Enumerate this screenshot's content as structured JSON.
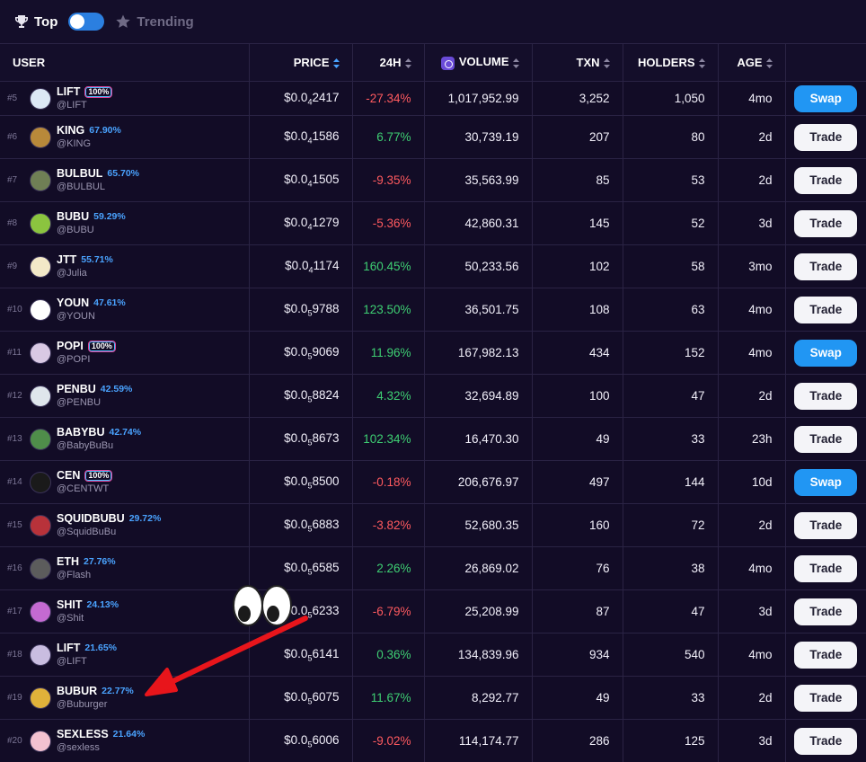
{
  "header": {
    "top_label": "Top",
    "trending_label": "Trending"
  },
  "columns": {
    "user": "USER",
    "price": "PRICE",
    "change": "24H",
    "volume": "VOLUME",
    "txn": "TXN",
    "holders": "HOLDERS",
    "age": "AGE"
  },
  "colors": {
    "accent_blue": "#2196f3",
    "percent_blue": "#4aa3ff",
    "negative": "#ff5a5f",
    "positive": "#3ecf73",
    "annotation_arrow": "#e8151b"
  },
  "rows": [
    {
      "rank": "#5",
      "symbol": "LIFT",
      "badge": "100%",
      "pct": "",
      "handle": "@LIFT",
      "price_pre": "$0.0",
      "price_sub": "4",
      "price_post": "2417",
      "change": "-27.34%",
      "volume": "1,017,952.99",
      "txn": "3,252",
      "holders": "1,050",
      "age": "4mo",
      "action": "Swap",
      "avatar": "#dce8f5"
    },
    {
      "rank": "#6",
      "symbol": "KING",
      "badge": "",
      "pct": "67.90%",
      "handle": "@KING",
      "price_pre": "$0.0",
      "price_sub": "4",
      "price_post": "1586",
      "change": "6.77%",
      "volume": "30,739.19",
      "txn": "207",
      "holders": "80",
      "age": "2d",
      "action": "Trade",
      "avatar": "#b8893a"
    },
    {
      "rank": "#7",
      "symbol": "BULBUL",
      "badge": "",
      "pct": "65.70%",
      "handle": "@BULBUL",
      "price_pre": "$0.0",
      "price_sub": "4",
      "price_post": "1505",
      "change": "-9.35%",
      "volume": "35,563.99",
      "txn": "85",
      "holders": "53",
      "age": "2d",
      "action": "Trade",
      "avatar": "#6f7f55"
    },
    {
      "rank": "#8",
      "symbol": "BUBU",
      "badge": "",
      "pct": "59.29%",
      "handle": "@BUBU",
      "price_pre": "$0.0",
      "price_sub": "4",
      "price_post": "1279",
      "change": "-5.36%",
      "volume": "42,860.31",
      "txn": "145",
      "holders": "52",
      "age": "3d",
      "action": "Trade",
      "avatar": "#8bc43f"
    },
    {
      "rank": "#9",
      "symbol": "JTT",
      "badge": "",
      "pct": "55.71%",
      "handle": "@Julia",
      "price_pre": "$0.0",
      "price_sub": "4",
      "price_post": "1174",
      "change": "160.45%",
      "volume": "50,233.56",
      "txn": "102",
      "holders": "58",
      "age": "3mo",
      "action": "Trade",
      "avatar": "#f3e9c8"
    },
    {
      "rank": "#10",
      "symbol": "YOUN",
      "badge": "",
      "pct": "47.61%",
      "handle": "@YOUN",
      "price_pre": "$0.0",
      "price_sub": "5",
      "price_post": "9788",
      "change": "123.50%",
      "volume": "36,501.75",
      "txn": "108",
      "holders": "63",
      "age": "4mo",
      "action": "Trade",
      "avatar": "#ffffff"
    },
    {
      "rank": "#11",
      "symbol": "POPI",
      "badge": "100%",
      "pct": "",
      "handle": "@POPI",
      "price_pre": "$0.0",
      "price_sub": "5",
      "price_post": "9069",
      "change": "11.96%",
      "volume": "167,982.13",
      "txn": "434",
      "holders": "152",
      "age": "4mo",
      "action": "Swap",
      "avatar": "#d9c9e4"
    },
    {
      "rank": "#12",
      "symbol": "PENBU",
      "badge": "",
      "pct": "42.59%",
      "handle": "@PENBU",
      "price_pre": "$0.0",
      "price_sub": "5",
      "price_post": "8824",
      "change": "4.32%",
      "volume": "32,694.89",
      "txn": "100",
      "holders": "47",
      "age": "2d",
      "action": "Trade",
      "avatar": "#dfe6ec"
    },
    {
      "rank": "#13",
      "symbol": "BABYBU",
      "badge": "",
      "pct": "42.74%",
      "handle": "@BabyBuBu",
      "price_pre": "$0.0",
      "price_sub": "5",
      "price_post": "8673",
      "change": "102.34%",
      "volume": "16,470.30",
      "txn": "49",
      "holders": "33",
      "age": "23h",
      "action": "Trade",
      "avatar": "#4f8d4a"
    },
    {
      "rank": "#14",
      "symbol": "CEN",
      "badge": "100%",
      "pct": "",
      "handle": "@CENTWT",
      "price_pre": "$0.0",
      "price_sub": "5",
      "price_post": "8500",
      "change": "-0.18%",
      "volume": "206,676.97",
      "txn": "497",
      "holders": "144",
      "age": "10d",
      "action": "Swap",
      "avatar": "#1a1a1a"
    },
    {
      "rank": "#15",
      "symbol": "SQUIDBUBU",
      "badge": "",
      "pct": "29.72%",
      "handle": "@SquidBuBu",
      "price_pre": "$0.0",
      "price_sub": "5",
      "price_post": "6883",
      "change": "-3.82%",
      "volume": "52,680.35",
      "txn": "160",
      "holders": "72",
      "age": "2d",
      "action": "Trade",
      "avatar": "#b8323a"
    },
    {
      "rank": "#16",
      "symbol": "ETH",
      "badge": "",
      "pct": "27.76%",
      "handle": "@Flash",
      "price_pre": "$0.0",
      "price_sub": "5",
      "price_post": "6585",
      "change": "2.26%",
      "volume": "26,869.02",
      "txn": "76",
      "holders": "38",
      "age": "4mo",
      "action": "Trade",
      "avatar": "#5c5c5c"
    },
    {
      "rank": "#17",
      "symbol": "SHIT",
      "badge": "",
      "pct": "24.13%",
      "handle": "@Shit",
      "price_pre": "$0.0",
      "price_sub": "5",
      "price_post": "6233",
      "change": "-6.79%",
      "volume": "25,208.99",
      "txn": "87",
      "holders": "47",
      "age": "3d",
      "action": "Trade",
      "avatar": "#c46ad2"
    },
    {
      "rank": "#18",
      "symbol": "LIFT",
      "badge": "",
      "pct": "21.65%",
      "handle": "@LIFT",
      "price_pre": "$0.0",
      "price_sub": "5",
      "price_post": "6141",
      "change": "0.36%",
      "volume": "134,839.96",
      "txn": "934",
      "holders": "540",
      "age": "4mo",
      "action": "Trade",
      "avatar": "#c9bde0"
    },
    {
      "rank": "#19",
      "symbol": "BUBUR",
      "badge": "",
      "pct": "22.77%",
      "handle": "@Buburger",
      "price_pre": "$0.0",
      "price_sub": "5",
      "price_post": "6075",
      "change": "11.67%",
      "volume": "8,292.77",
      "txn": "49",
      "holders": "33",
      "age": "2d",
      "action": "Trade",
      "avatar": "#e0b23a"
    },
    {
      "rank": "#20",
      "symbol": "SEXLESS",
      "badge": "",
      "pct": "21.64%",
      "handle": "@sexless",
      "price_pre": "$0.0",
      "price_sub": "5",
      "price_post": "6006",
      "change": "-9.02%",
      "volume": "114,174.77",
      "txn": "286",
      "holders": "125",
      "age": "3d",
      "action": "Trade",
      "avatar": "#f3c2d0"
    }
  ]
}
